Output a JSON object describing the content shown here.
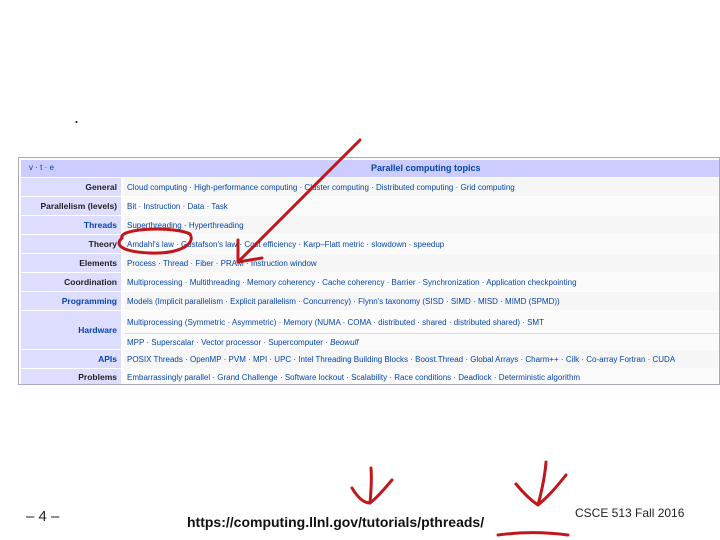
{
  "slide": {
    "bullet": ".",
    "page_number": "– 4 –",
    "url": "https://computing.llnl.gov/tutorials/pthreads/",
    "course": "CSCE 513 Fall 2016"
  },
  "navbox": {
    "vte": "v · t · e",
    "title": "Parallel computing topics",
    "rows": [
      {
        "group": "General",
        "items": "Cloud computing · High-performance computing · Cluster computing · Distributed computing · Grid computing"
      },
      {
        "group": "Parallelism (levels)",
        "items": "Bit · Instruction · Data · Task"
      },
      {
        "group": "Threads",
        "items": "Superthreading · Hyperthreading"
      },
      {
        "group": "Theory",
        "items": "Amdahl's law · Gustafson's law · Cost efficiency · Karp–Flatt metric · slowdown · speedup"
      },
      {
        "group": "Elements",
        "items": "Process · Thread · Fiber · PRAM · Instruction window"
      },
      {
        "group": "Coordination",
        "items": "Multiprocessing · Multithreading · Memory coherency · Cache coherency · Barrier · Synchronization · Application checkpointing"
      },
      {
        "group": "Programming",
        "items": "Models (Implicit parallelism · Explicit parallelism · Concurrency) · Flynn's taxonomy (SISD · SIMD · MISD · MIMD (SPMD))"
      },
      {
        "group": "Hardware",
        "items_line1": "Multiprocessing (Symmetric · Asymmetric) · Memory (NUMA · COMA · distributed · shared · distributed shared) · SMT",
        "items_line2_a": "MPP · Superscalar · Vector processor · Supercomputer · ",
        "items_line2_b": "Beowulf"
      },
      {
        "group": "APIs",
        "items": "POSIX Threads · OpenMP · PVM · MPI · UPC · Intel Threading Building Blocks · Boost.Thread · Global Arrays · Charm++ · Cilk · Co-array Fortran · CUDA"
      },
      {
        "group": "Problems",
        "items": "Embarrassingly parallel · Grand Challenge · Software lockout · Scalability · Race conditions · Deadlock · Deterministic algorithm"
      }
    ]
  },
  "annotation": {
    "ink_color": "#c0171d"
  }
}
